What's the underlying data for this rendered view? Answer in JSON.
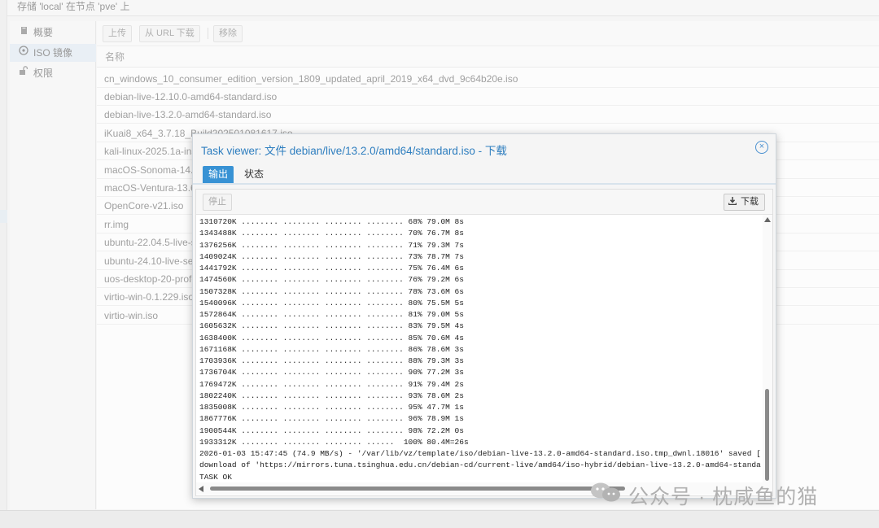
{
  "breadcrumb": "存储 'local' 在节点 'pve' 上",
  "sidebar": {
    "items": [
      {
        "label": "概要",
        "icon": "book-icon"
      },
      {
        "label": "ISO 镜像",
        "icon": "disc-icon"
      },
      {
        "label": "权限",
        "icon": "unlock-icon"
      }
    ]
  },
  "toolbar": {
    "upload_label": "上传",
    "download_url_label": "从 URL 下载",
    "remove_label": "移除"
  },
  "table": {
    "column_header": "名称",
    "rows": [
      "cn_windows_10_consumer_edition_version_1809_updated_april_2019_x64_dvd_9c64b20e.iso",
      "debian-live-12.10.0-amd64-standard.iso",
      "debian-live-13.2.0-amd64-standard.iso",
      "iKuai8_x64_3.7.18_Build202501081617.iso",
      "kali-linux-2025.1a-ins",
      "macOS-Sonoma-14.",
      "macOS-Ventura-13.6",
      "OpenCore-v21.iso",
      "rr.img",
      "ubuntu-22.04.5-live-s",
      "ubuntu-24.10-live-ser",
      "uos-desktop-20-profe",
      "virtio-win-0.1.229.iso",
      "virtio-win.iso"
    ]
  },
  "task_viewer": {
    "title": "Task viewer: 文件 debian/live/13.2.0/amd64/standard.iso - 下载",
    "tabs": [
      "输出",
      "状态"
    ],
    "stop_label": "停止",
    "download_label": "下载",
    "log_lines": [
      "1310720K ........ ........ ........ ........ 68% 79.0M 8s",
      "1343488K ........ ........ ........ ........ 70% 76.7M 8s",
      "1376256K ........ ........ ........ ........ 71% 79.3M 7s",
      "1409024K ........ ........ ........ ........ 73% 78.7M 7s",
      "1441792K ........ ........ ........ ........ 75% 76.4M 6s",
      "1474560K ........ ........ ........ ........ 76% 79.2M 6s",
      "1507328K ........ ........ ........ ........ 78% 73.6M 6s",
      "1540096K ........ ........ ........ ........ 80% 75.5M 5s",
      "1572864K ........ ........ ........ ........ 81% 79.0M 5s",
      "1605632K ........ ........ ........ ........ 83% 79.5M 4s",
      "1638400K ........ ........ ........ ........ 85% 70.6M 4s",
      "1671168K ........ ........ ........ ........ 86% 78.6M 3s",
      "1703936K ........ ........ ........ ........ 88% 79.3M 3s",
      "1736704K ........ ........ ........ ........ 90% 77.2M 3s",
      "1769472K ........ ........ ........ ........ 91% 79.4M 2s",
      "1802240K ........ ........ ........ ........ 93% 78.6M 2s",
      "1835008K ........ ........ ........ ........ 95% 47.7M 1s",
      "1867776K ........ ........ ........ ........ 96% 78.9M 1s",
      "1900544K ........ ........ ........ ........ 98% 72.2M 0s",
      "1933312K ........ ........ ........ ......  100% 80.4M=26s",
      "2026-01-03 15:47:45 (74.9 MB/s) - '/var/lib/vz/template/iso/debian-live-13.2.0-amd64-standard.iso.tmp_dwnl.18016' saved [2011299840/2011299840]",
      "download of 'https://mirrors.tuna.tsinghua.edu.cn/debian-cd/current-live/amd64/iso-hybrid/debian-live-13.2.0-amd64-standard.iso' to '/var/lib/vz/template/iso/d",
      "TASK OK"
    ]
  },
  "watermark": {
    "text": "公众号 · 枕咸鱼的猫"
  },
  "colors": {
    "accent": "#3892d4",
    "title_blue": "#2e7ebf"
  }
}
